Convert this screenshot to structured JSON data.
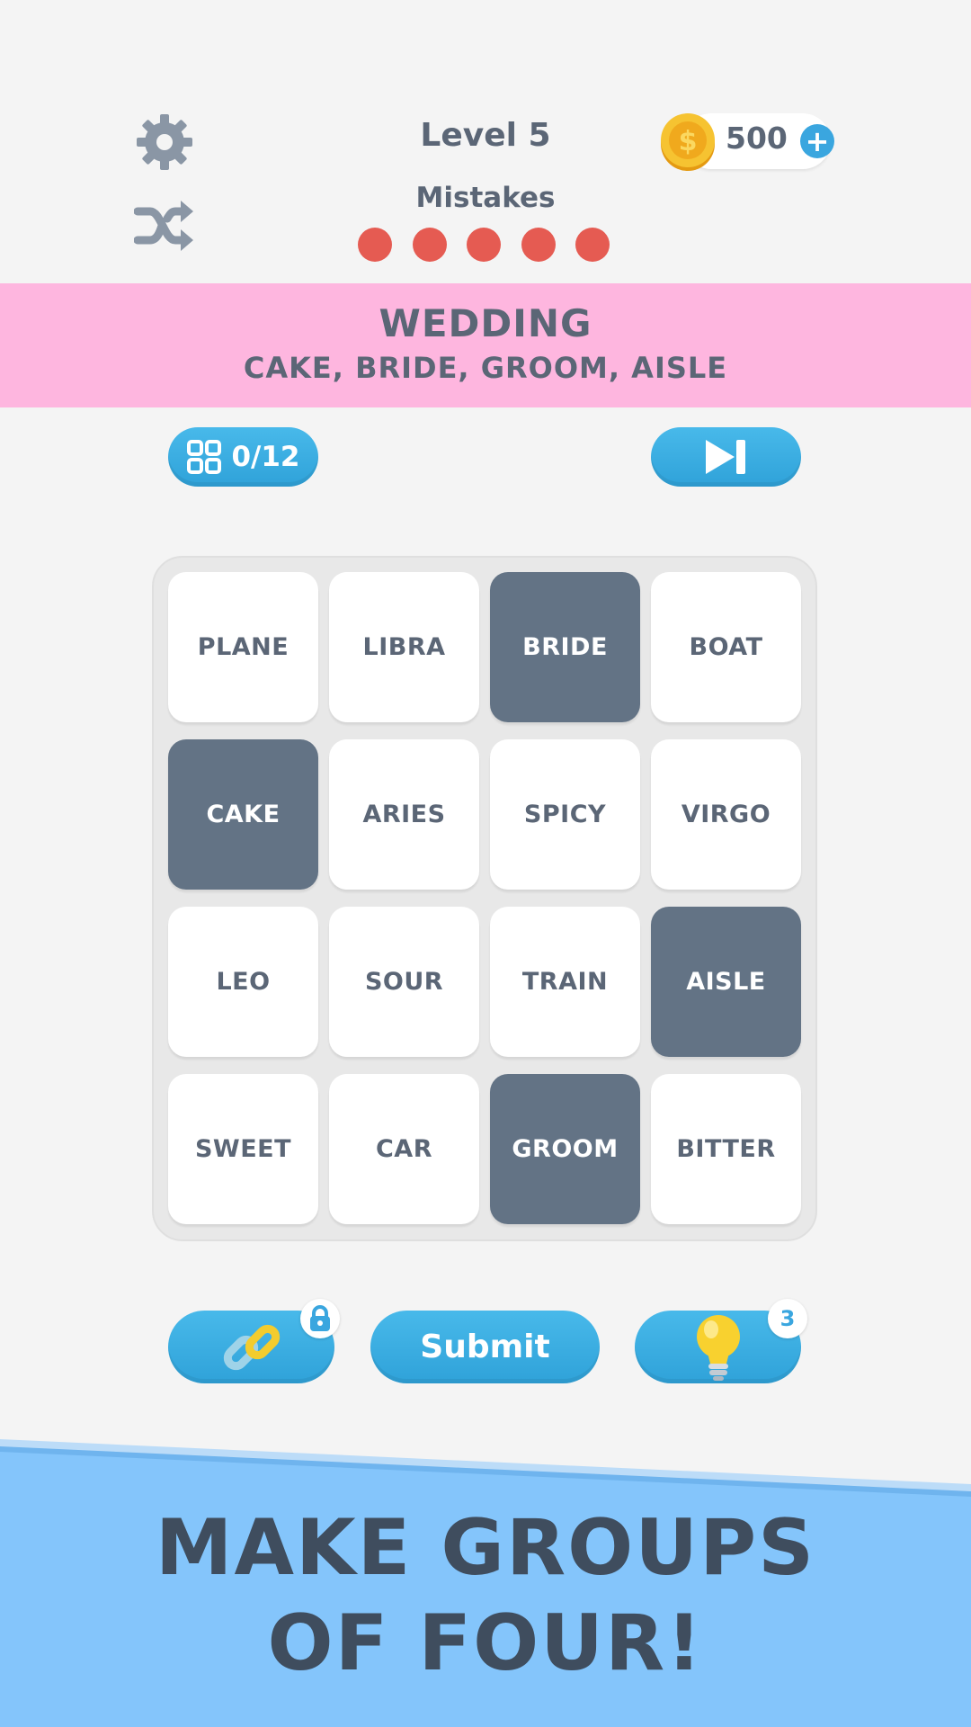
{
  "header": {
    "level_label": "Level 5",
    "mistakes_label": "Mistakes",
    "mistakes_remaining": 5,
    "coins": "500",
    "icons": {
      "settings": "gear-icon",
      "shuffle": "shuffle-icon",
      "coin": "coin-icon",
      "add": "plus-icon"
    }
  },
  "banner": {
    "title": "WEDDING",
    "words": "CAKE, BRIDE, GROOM, AISLE",
    "color": "#feb6df"
  },
  "progress": {
    "label": "0/12",
    "icon": "grid-icon"
  },
  "skip": {
    "icon": "skip-icon"
  },
  "board": {
    "tiles": [
      {
        "word": "PLANE",
        "selected": false
      },
      {
        "word": "LIBRA",
        "selected": false
      },
      {
        "word": "BRIDE",
        "selected": true
      },
      {
        "word": "BOAT",
        "selected": false
      },
      {
        "word": "CAKE",
        "selected": true
      },
      {
        "word": "ARIES",
        "selected": false
      },
      {
        "word": "SPICY",
        "selected": false
      },
      {
        "word": "VIRGO",
        "selected": false
      },
      {
        "word": "LEO",
        "selected": false
      },
      {
        "word": "SOUR",
        "selected": false
      },
      {
        "word": "TRAIN",
        "selected": false
      },
      {
        "word": "AISLE",
        "selected": true
      },
      {
        "word": "SWEET",
        "selected": false
      },
      {
        "word": "CAR",
        "selected": false
      },
      {
        "word": "GROOM",
        "selected": true
      },
      {
        "word": "BITTER",
        "selected": false
      }
    ]
  },
  "actions": {
    "link_icon": "link-icon",
    "lock_icon": "lock-icon",
    "submit_label": "Submit",
    "hint_icon": "lightbulb-icon",
    "hint_count": "3"
  },
  "promo": {
    "line1": "MAKE GROUPS",
    "line2": "OF FOUR!"
  },
  "colors": {
    "accent": "#3aa6df",
    "tile_selected": "#637385",
    "mistake_dot": "#e55b52",
    "promo_bg": "#84c5fb",
    "text": "#5b6676"
  }
}
